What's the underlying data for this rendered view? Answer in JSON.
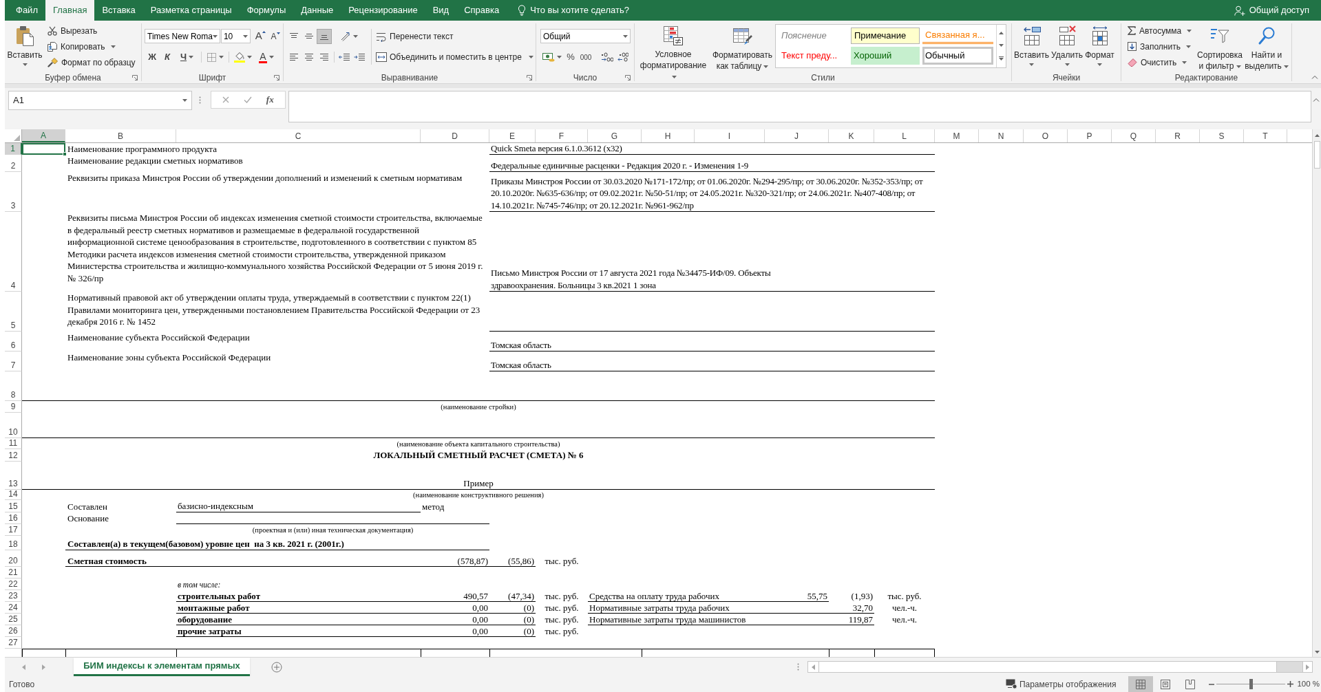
{
  "tabs": [
    {
      "label": "Файл",
      "selected": false
    },
    {
      "label": "Главная",
      "selected": true
    },
    {
      "label": "Вставка",
      "selected": false
    },
    {
      "label": "Разметка страницы",
      "selected": false
    },
    {
      "label": "Формулы",
      "selected": false
    },
    {
      "label": "Данные",
      "selected": false
    },
    {
      "label": "Рецензирование",
      "selected": false
    },
    {
      "label": "Вид",
      "selected": false
    },
    {
      "label": "Справка",
      "selected": false
    }
  ],
  "tell_me": {
    "placeholder": "Что вы хотите сделать?"
  },
  "share": "Общий доступ",
  "clipboard": {
    "label": "Буфер обмена",
    "paste": "Вставить",
    "cut": "Вырезать",
    "copy": "Копировать",
    "format_painter": "Формат по образцу"
  },
  "font": {
    "label": "Шрифт",
    "font_name": "Times New Roma",
    "font_size": "10",
    "grow": "A",
    "shrink": "A",
    "bold": "Ж",
    "italic": "К",
    "underline": "Ч",
    "font_color": "A"
  },
  "alignment": {
    "label": "Выравнивание",
    "vertical": [
      {
        "kind": "top",
        "selected": false
      },
      {
        "kind": "middle",
        "selected": false
      },
      {
        "kind": "bottom",
        "selected": true
      }
    ],
    "wrap_text": "Перенести текст",
    "merge": "Объединить и поместить в центре"
  },
  "number": {
    "label": "Число",
    "format": "Общий",
    "percent": "%",
    "thousands": "000"
  },
  "styles": {
    "label": "Стили",
    "conditional": "Условное\nформатирование",
    "format_table": "Форматировать\nкак таблицу",
    "gallery": [
      {
        "label": "Пояснение",
        "kind": "explanatory",
        "selected": false
      },
      {
        "label": "Примечание",
        "kind": "note",
        "selected": false
      },
      {
        "label": "Связанная я...",
        "kind": "linked",
        "selected": false
      },
      {
        "label": "Текст преду...",
        "kind": "warning",
        "selected": false
      },
      {
        "label": "Хороший",
        "kind": "good",
        "selected": false
      },
      {
        "label": "Обычный",
        "kind": "normal",
        "selected": true
      }
    ]
  },
  "cells": {
    "label": "Ячейки",
    "insert": "Вставить",
    "delete": "Удалить",
    "format": "Формат"
  },
  "editing": {
    "label": "Редактирование",
    "autosum": "Автосумма",
    "fill": "Заполнить",
    "clear": "Очистить",
    "sort": "Сортировка\nи фильтр",
    "find": "Найти и\nвыделить"
  },
  "formula_bar": {
    "name_box": "A1",
    "function_label": "fx"
  },
  "sheet": {
    "columns": [
      {
        "label": "A",
        "selected": true
      },
      {
        "label": "B",
        "selected": false
      },
      {
        "label": "C",
        "selected": false
      },
      {
        "label": "D",
        "selected": false
      },
      {
        "label": "E",
        "selected": false
      },
      {
        "label": "F",
        "selected": false
      },
      {
        "label": "G",
        "selected": false
      },
      {
        "label": "H",
        "selected": false
      },
      {
        "label": "I",
        "selected": false
      },
      {
        "label": "J",
        "selected": false
      },
      {
        "label": "K",
        "selected": false
      },
      {
        "label": "L",
        "selected": false
      },
      {
        "label": "M",
        "selected": false
      },
      {
        "label": "N",
        "selected": false
      },
      {
        "label": "O",
        "selected": false
      },
      {
        "label": "P",
        "selected": false
      },
      {
        "label": "Q",
        "selected": false
      },
      {
        "label": "R",
        "selected": false
      },
      {
        "label": "S",
        "selected": false
      },
      {
        "label": "T",
        "selected": false
      }
    ],
    "rows": [
      {
        "number": "1",
        "selected": true,
        "kind": "field",
        "label": "Наименование программного продукта",
        "value": "Quick Smeta версия 6.1.0.3612 (x32)"
      },
      {
        "number": "2",
        "selected": false,
        "kind": "field",
        "label": "Наименование редакции сметных нормативов",
        "value": "Федеральные единичные расценки - Редакция 2020 г. - Изменения 1-9"
      },
      {
        "number": "3",
        "selected": false,
        "kind": "field",
        "label": "Реквизиты приказа Минстроя России об утверждении дополнений и изменений к сметным нормативам",
        "value": "Приказы Минстроя России от 30.03.2020 №171-172/пр; от 01.06.2020г. №294-295/пр; от 30.06.2020г. №352-353/пр; от\n20.10.2020г. №635-636/пр; от 09.02.2021г. №50-51/пр; от 24.05.2021г. №320-321/пр; от 24.06.2021г. №407-408/пр; от\n14.10.2021г. №745-746/пр; от 20.12.2021г. №961-962/пр"
      },
      {
        "number": "4",
        "selected": false,
        "kind": "field",
        "label": "Реквизиты письма Минстроя России об индексах изменения сметной стоимости строительства, включаемые\nв федеральный реестр сметных нормативов и размещаемые в федеральной государственной\nинформационной системе ценообразования в строительстве, подготовленного в соответствии с пунктом 85\nМетодики расчета индексов изменения сметной стоимости строительства, утвержденной приказом\nМинистерства строительства и жилищно-коммунального хозяйства Российской Федерации от 5 июня 2019 г.\n№ 326/пр",
        "value": "Письмо Минстроя России от 17 августа 2021 года №34475-ИФ/09. Объекты\nздравоохранения. Больницы 3 кв.2021 1 зона"
      },
      {
        "number": "5",
        "selected": false,
        "kind": "field",
        "label": "Нормативный правовой акт об утверждении оплаты труда, утверждаемый в соответствии с пунктом 22(1)\nПравилами мониторинга цен, утвержденными постановлением Правительства Российской Федерации от 23\nдекабря 2016 г. № 1452"
      },
      {
        "number": "6",
        "selected": false,
        "kind": "field",
        "label": "Наименование субъекта Российской Федерации",
        "value": "Томская область"
      },
      {
        "number": "7",
        "selected": false,
        "kind": "field",
        "label": "Наименование зоны субъекта Российской Федерации",
        "value": "Томская область"
      },
      {
        "number": "8",
        "selected": false,
        "kind": "rule"
      },
      {
        "number": "9",
        "selected": false,
        "kind": "caption",
        "text": "(наименование стройки)"
      },
      {
        "number": "10",
        "selected": false,
        "kind": "rule"
      },
      {
        "number": "11",
        "selected": false,
        "kind": "caption",
        "text": "(наименование объекта капитального строительства)"
      },
      {
        "number": "12",
        "selected": false,
        "kind": "title",
        "text": "ЛОКАЛЬНЫЙ СМЕТНЫЙ РАСЧЕТ (СМЕТА) № 6"
      },
      {
        "number": "13",
        "selected": false,
        "kind": "heading",
        "text": "Пример"
      },
      {
        "number": "14",
        "selected": false,
        "kind": "caption",
        "text": "(наименование конструктивного решения)"
      },
      {
        "number": "15",
        "selected": false,
        "kind": "method",
        "label": "Составлен",
        "method": "базисно-индексным",
        "suffix": "метод"
      },
      {
        "number": "16",
        "selected": false,
        "kind": "basis",
        "label": "Основание"
      },
      {
        "number": "17",
        "selected": false,
        "kind": "subcaption",
        "text": "(проектная и (или) иная техническая документация)"
      },
      {
        "number": "18",
        "selected": false,
        "kind": "price_level",
        "text": "Составлен(а) в текущем(базовом) уровне цен  на 3 кв. 2021 г. (2001г.)"
      },
      {
        "number": "20",
        "selected": false,
        "kind": "total",
        "label": "Сметная стоимость",
        "values": [
          "(578,87)",
          "(55,86)"
        ],
        "unit": "тыс. руб."
      },
      {
        "number": "21",
        "selected": false,
        "kind": "empty"
      },
      {
        "number": "22",
        "selected": false,
        "kind": "note",
        "text": "в том числе:"
      },
      {
        "number": "23",
        "selected": false,
        "kind": "breakdown",
        "label": "строительных работ",
        "values": [
          "490,57",
          "(47,34)"
        ],
        "unit": "тыс. руб.",
        "side": {
          "label": "Средства на оплату труда рабочих",
          "values": [
            "55,75",
            "(1,93)"
          ],
          "unit": "тыс. руб."
        }
      },
      {
        "number": "24",
        "selected": false,
        "kind": "breakdown",
        "label": "монтажные работ",
        "values": [
          "0,00",
          "(0)"
        ],
        "unit": "тыс. руб.",
        "side": {
          "label": "Нормативные затраты труда рабочих",
          "values": [
            "32,70"
          ],
          "unit": "чел.-ч."
        }
      },
      {
        "number": "25",
        "selected": false,
        "kind": "breakdown",
        "label": "оборудование",
        "values": [
          "0,00",
          "(0)"
        ],
        "unit": "тыс. руб.",
        "side": {
          "label": "Нормативные затраты труда машинистов",
          "values": [
            "119,87"
          ],
          "unit": "чел.-ч."
        }
      },
      {
        "number": "26",
        "selected": false,
        "kind": "breakdown",
        "label": "прочие затраты",
        "values": [
          "0,00",
          "(0)"
        ],
        "unit": "тыс. руб."
      },
      {
        "number": "27",
        "selected": false,
        "kind": "empty"
      },
      {
        "selected": false,
        "kind": "table_top"
      }
    ]
  },
  "sheet_tabs": [
    {
      "label": "БИМ индексы к элементам прямых",
      "selected": true
    }
  ],
  "status_bar": {
    "status": "Готово",
    "display_settings": "Параметры отображения",
    "views": [
      {
        "kind": "normal",
        "selected": true
      },
      {
        "kind": "page_layout",
        "selected": false
      },
      {
        "kind": "page_break",
        "selected": false
      }
    ],
    "zoom": {
      "level": 0.5,
      "reading": "100 %"
    }
  }
}
